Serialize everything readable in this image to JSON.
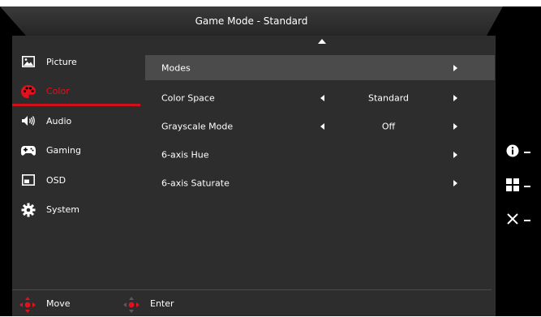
{
  "header": {
    "title": "Game Mode - Standard"
  },
  "sidebar": {
    "items": [
      {
        "label": "Picture",
        "icon": "picture-icon"
      },
      {
        "label": "Color",
        "icon": "color-palette-icon"
      },
      {
        "label": "Audio",
        "icon": "speaker-icon"
      },
      {
        "label": "Gaming",
        "icon": "gamepad-icon"
      },
      {
        "label": "OSD",
        "icon": "osd-icon"
      },
      {
        "label": "System",
        "icon": "gear-icon"
      }
    ],
    "active": "Color"
  },
  "menu": {
    "rows": [
      {
        "label": "Modes",
        "value": ""
      },
      {
        "label": "Color Space",
        "value": "Standard"
      },
      {
        "label": "Grayscale Mode",
        "value": "Off"
      },
      {
        "label": "6-axis Hue",
        "value": ""
      },
      {
        "label": "6-axis Saturate",
        "value": ""
      }
    ]
  },
  "footer": {
    "move_label": "Move",
    "enter_label": "Enter"
  },
  "hotkeys": [
    "info-icon",
    "menu-grid-icon",
    "close-icon"
  ],
  "colors": {
    "accent": "#d0111b",
    "panel": "#2d2d2d",
    "selected_row": "#4b4b4b"
  }
}
